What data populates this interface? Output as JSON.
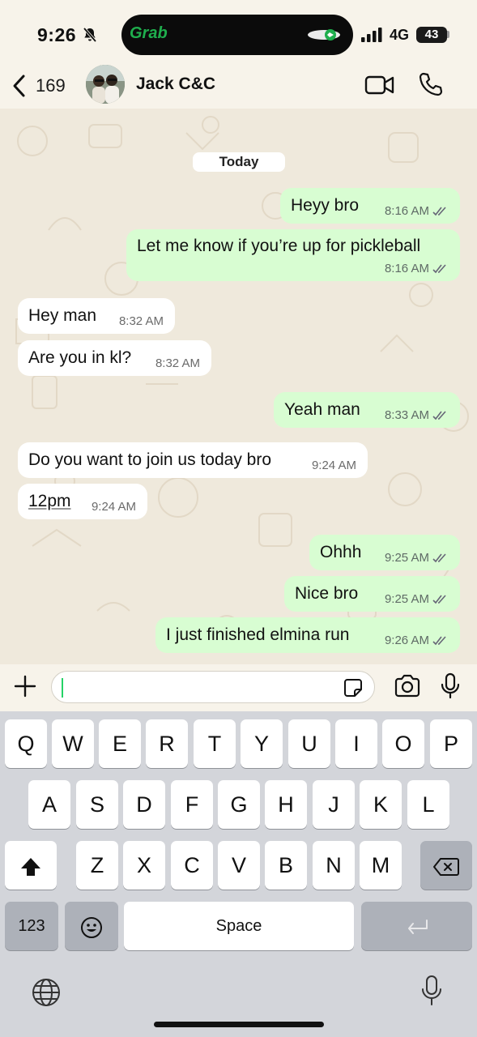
{
  "status_bar": {
    "time": "9:26",
    "dynamic_island_app": "Grab",
    "network": "4G",
    "battery": "43"
  },
  "header": {
    "back_count": "169",
    "contact_name": "Jack C&C"
  },
  "chat": {
    "date_label": "Today",
    "messages": [
      {
        "dir": "out",
        "text": "Heyy bro",
        "time": "8:16 AM",
        "ticks": true
      },
      {
        "dir": "out",
        "text": "Let me know if you’re up for pickleball",
        "time": "8:16 AM",
        "ticks": true
      },
      {
        "dir": "in",
        "text": "Hey man",
        "time": "8:32 AM"
      },
      {
        "dir": "in",
        "text": "Are you in kl?",
        "time": "8:32 AM"
      },
      {
        "dir": "out",
        "text": "Yeah man",
        "time": "8:33 AM",
        "ticks": true
      },
      {
        "dir": "in",
        "text": "Do you want to join us today bro",
        "time": "9:24 AM"
      },
      {
        "dir": "in",
        "text": "12pm",
        "time": "9:24 AM"
      },
      {
        "dir": "out",
        "text": "Ohhh",
        "time": "9:25 AM",
        "ticks": true
      },
      {
        "dir": "out",
        "text": "Nice bro",
        "time": "9:25 AM",
        "ticks": true
      },
      {
        "dir": "out",
        "text": "I just finished elmina run",
        "time": "9:26 AM",
        "ticks": true
      }
    ]
  },
  "input": {
    "value": ""
  },
  "keyboard": {
    "row1": [
      "Q",
      "W",
      "E",
      "R",
      "T",
      "Y",
      "U",
      "I",
      "O",
      "P"
    ],
    "row2": [
      "A",
      "S",
      "D",
      "F",
      "G",
      "H",
      "J",
      "K",
      "L"
    ],
    "row3": [
      "Z",
      "X",
      "C",
      "V",
      "B",
      "N",
      "M"
    ],
    "numbers_label": "123",
    "space_label": "Space"
  },
  "colors": {
    "outgoing_bubble": "#d8fdd2",
    "incoming_bubble": "#ffffff",
    "wallpaper": "#efe9dc",
    "accent": "#25d366"
  }
}
